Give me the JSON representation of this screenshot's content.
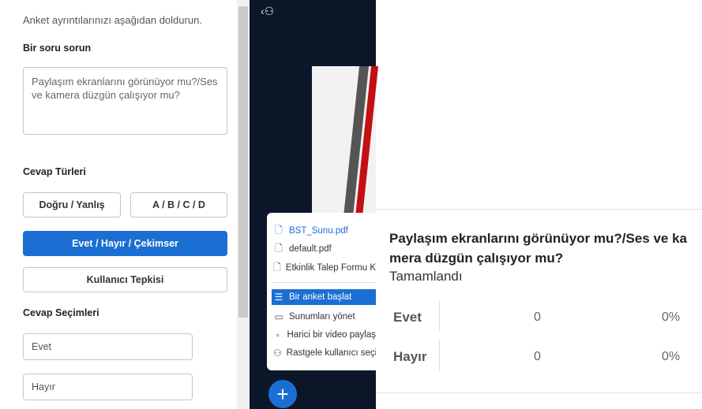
{
  "poll_form": {
    "intro": "Anket ayrıntılarınızı aşağıdan doldurun.",
    "question_heading": "Bir soru sorun",
    "question_text": "Paylaşım ekranlarını görünüyor mu?/Ses ve kamera düzgün çalışıyor mu?",
    "answer_types_heading": "Cevap Türleri",
    "btn_true_false": "Doğru / Yanlış",
    "btn_abcd": "A / B / C / D",
    "btn_yes_no_abstain": "Evet / Hayır / Çekimser",
    "btn_user_reaction": "Kullanıcı Tepkisi",
    "answer_choices_heading": "Cevap Seçimleri",
    "choices": [
      "Evet",
      "Hayır"
    ]
  },
  "menu": {
    "files": [
      "BST_Sunu.pdf",
      "default.pdf",
      "Etkinlik Talep Formu K"
    ],
    "actions": [
      "Bir anket başlat",
      "Sunumları yönet",
      "Harici bir video paylaş",
      "Rastgele kullanıcı seçi"
    ]
  },
  "fab_label": "+",
  "user_icon": "‹⚇",
  "result": {
    "question": "Paylaşım ekranlarını görünüyor mu?/Ses ve kamera düzgün çalışıyor mu?",
    "status": "Tamamlandı",
    "rows": [
      {
        "label": "Evet",
        "count": "0",
        "percent": "0%"
      },
      {
        "label": "Hayır",
        "count": "0",
        "percent": "0%"
      }
    ]
  },
  "colors": {
    "accent": "#1b6fd3",
    "dark_bg": "#0b1729"
  }
}
